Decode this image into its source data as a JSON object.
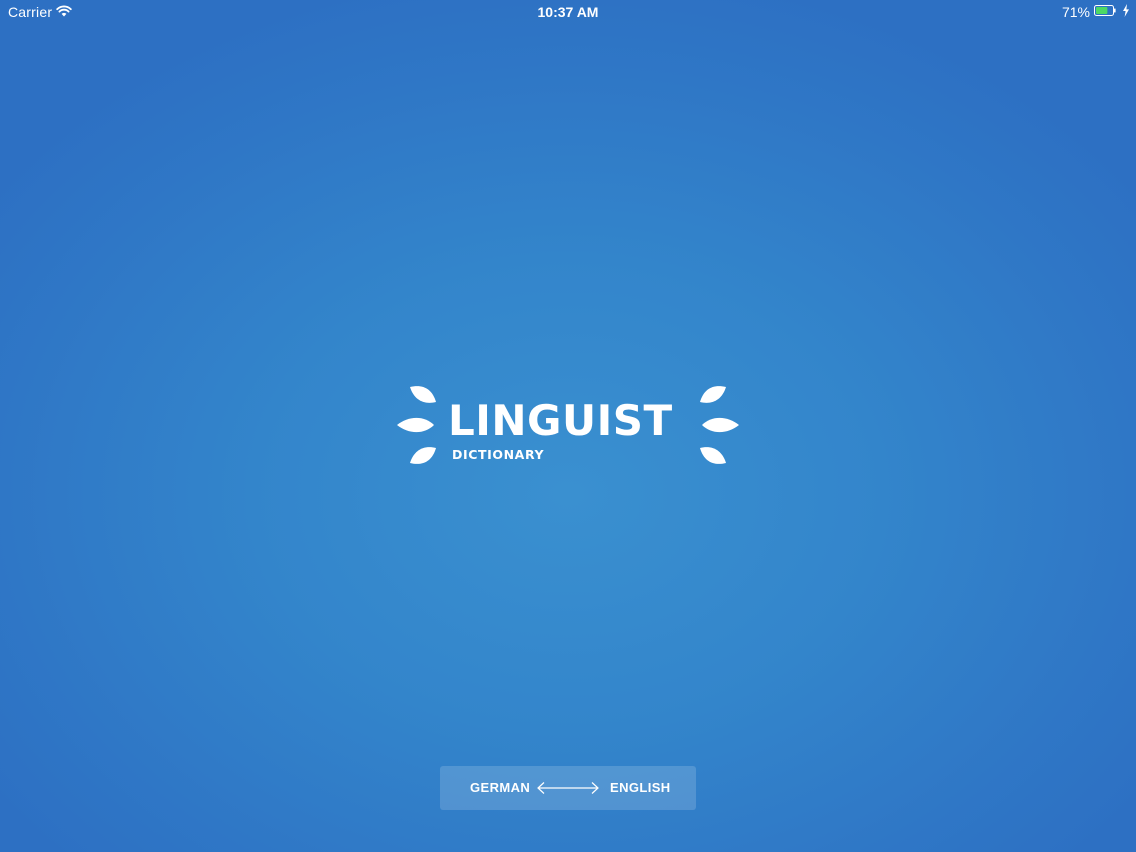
{
  "status_bar": {
    "carrier": "Carrier",
    "time": "10:37 AM",
    "battery_percent": "71%",
    "battery_level": 0.71,
    "icons": [
      "wifi-icon",
      "battery-icon",
      "charging-bolt-icon"
    ]
  },
  "logo": {
    "title": "LINGUIST",
    "subtitle": "DICTIONARY",
    "icon": "laurel-leaves-icon"
  },
  "language_pair": {
    "from": "GERMAN",
    "to": "ENGLISH",
    "icon": "bidirectional-arrow-icon"
  },
  "colors": {
    "background_center": "#3a90d0",
    "background_edge": "#2d70c3",
    "text": "#ffffff",
    "battery_fill": "#4cd964"
  }
}
